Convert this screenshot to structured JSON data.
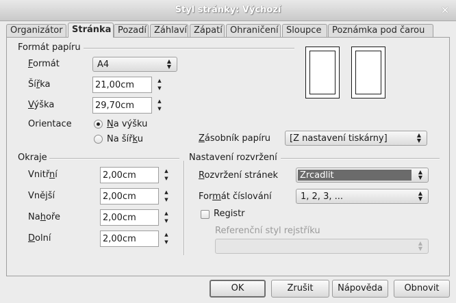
{
  "window": {
    "title": "Styl stránky: Výchozí",
    "close_glyph": "✕"
  },
  "tabs": [
    {
      "label": "Organizátor"
    },
    {
      "label": "Stránka"
    },
    {
      "label": "Pozadí"
    },
    {
      "label": "Záhlaví"
    },
    {
      "label": "Zápatí"
    },
    {
      "label": "Ohraničení"
    },
    {
      "label": "Sloupce"
    },
    {
      "label": "Poznámka pod čarou"
    }
  ],
  "paper": {
    "group_title": "Formát papíru",
    "format": {
      "label_pre": "",
      "label_u": "F",
      "label_post": "ormát",
      "value": "A4"
    },
    "width": {
      "label_pre": "Ší",
      "label_u": "ř",
      "label_post": "ka",
      "value": "21,00cm"
    },
    "height": {
      "label_pre": "",
      "label_u": "V",
      "label_post": "ýška",
      "value": "29,70cm"
    },
    "orientation": {
      "label": "Orientace",
      "portrait": {
        "label_pre": "",
        "label_u": "N",
        "label_post": "a výšku",
        "checked": true
      },
      "landscape": {
        "label_pre": "Na šíř",
        "label_u": "k",
        "label_post": "u",
        "checked": false
      }
    },
    "tray": {
      "label_pre": "",
      "label_u": "Z",
      "label_post": "ásobník papíru",
      "value": "[Z nastavení tiskárny]"
    }
  },
  "margins": {
    "group_title": "Okraje",
    "inner": {
      "label_pre": "Vnitř",
      "label_u": "n",
      "label_post": "í",
      "value": "2,00cm"
    },
    "outer": {
      "label_pre": "Vně",
      "label_u": "j",
      "label_post": "ší",
      "value": "2,00cm"
    },
    "top": {
      "label_pre": "Na",
      "label_u": "h",
      "label_post": "oře",
      "value": "2,00cm"
    },
    "bottom": {
      "label_pre": "",
      "label_u": "D",
      "label_post": "olní",
      "value": "2,00cm"
    }
  },
  "layout": {
    "group_title": "Nastavení rozvržení",
    "page_layout": {
      "label_pre": "",
      "label_u": "R",
      "label_post": "ozvržení stránek",
      "value": "Zrcadlit"
    },
    "numbering": {
      "label_pre": "For",
      "label_u": "m",
      "label_post": "át číslování",
      "value": "1, 2, 3, ..."
    },
    "register": {
      "label": "Registr",
      "checked": false
    },
    "ref_style": {
      "label": "Referenční styl rejstříku",
      "value": ""
    }
  },
  "buttons": {
    "ok": "OK",
    "cancel": "Zrušit",
    "help": "Nápověda",
    "reset": "Obnovit"
  },
  "colors": {
    "dialog_bg": "#ececec",
    "selection": "#6b6b6b"
  }
}
